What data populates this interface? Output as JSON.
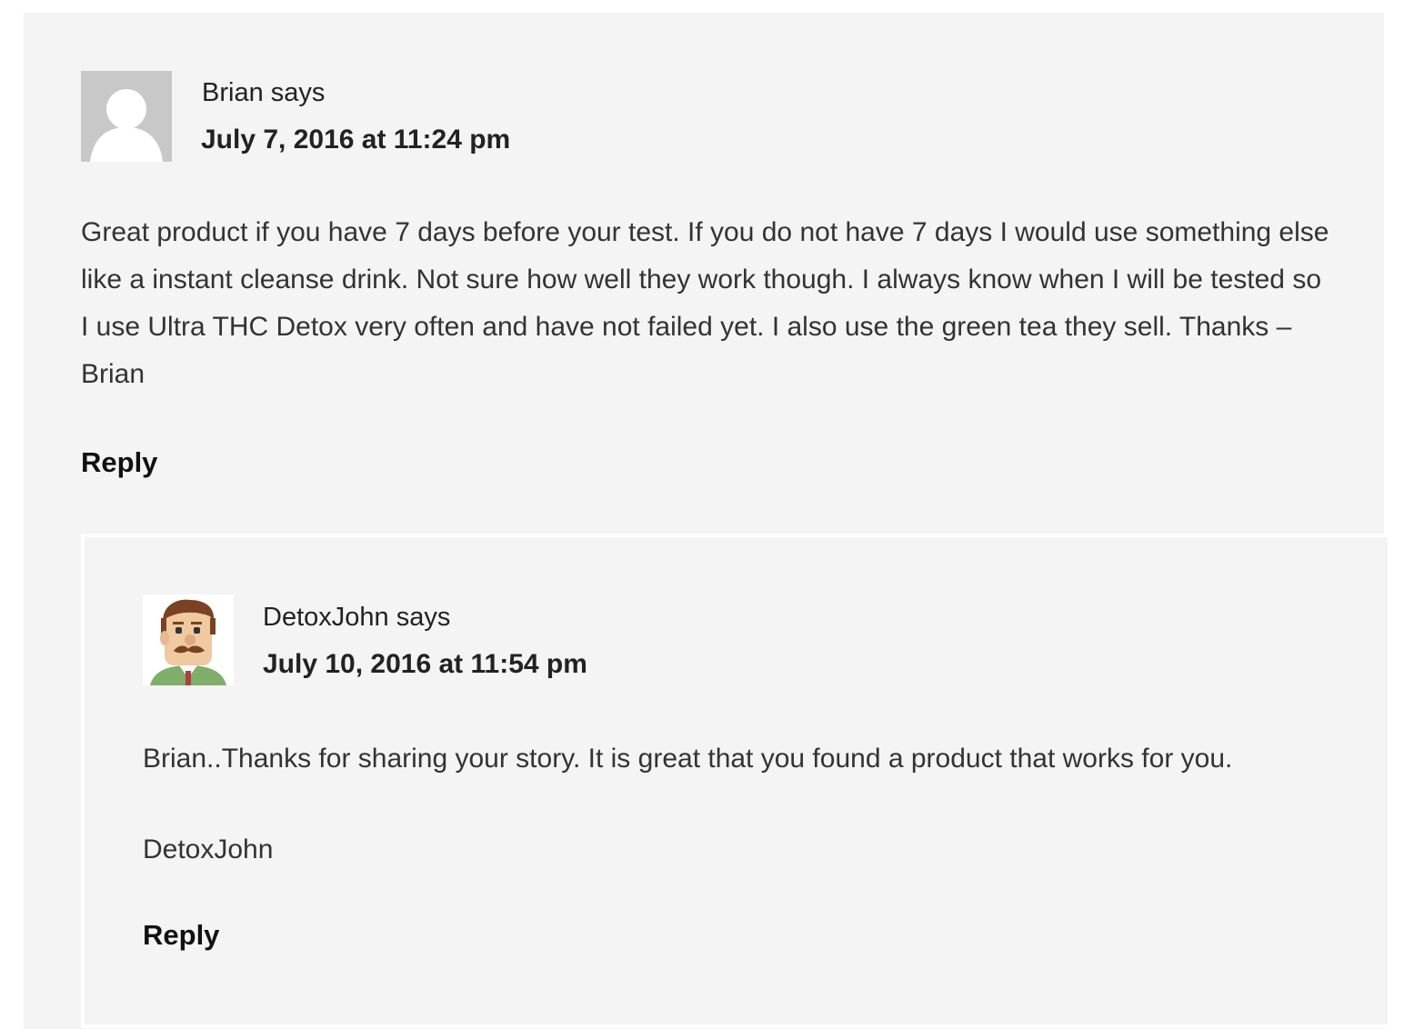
{
  "comments": [
    {
      "author": "Brian",
      "says": "says",
      "date": "July 7, 2016 at 11:24 pm",
      "avatar_icon": "default-user-avatar-icon",
      "text": "Great product if you have 7 days before your test. If you do not have 7 days I would use something else like a instant cleanse drink. Not sure how well they work though. I always know when I will be tested so I use Ultra THC Detox very often and have not failed yet. I also use the green tea they sell. Thanks – Brian",
      "reply_label": "Reply"
    },
    {
      "author": "DetoxJohn",
      "says": "says",
      "date": "July 10, 2016 at 11:54 pm",
      "avatar_icon": "cartoon-man-avatar-icon",
      "text_paragraphs": [
        "Brian..Thanks for sharing your story. It is great that you found a product that works for you.",
        "DetoxJohn"
      ],
      "reply_label": "Reply"
    }
  ],
  "colors": {
    "panel_background": "#f4f4f4",
    "child_border": "#ffffff",
    "text": "#333333",
    "heading": "#222222"
  }
}
